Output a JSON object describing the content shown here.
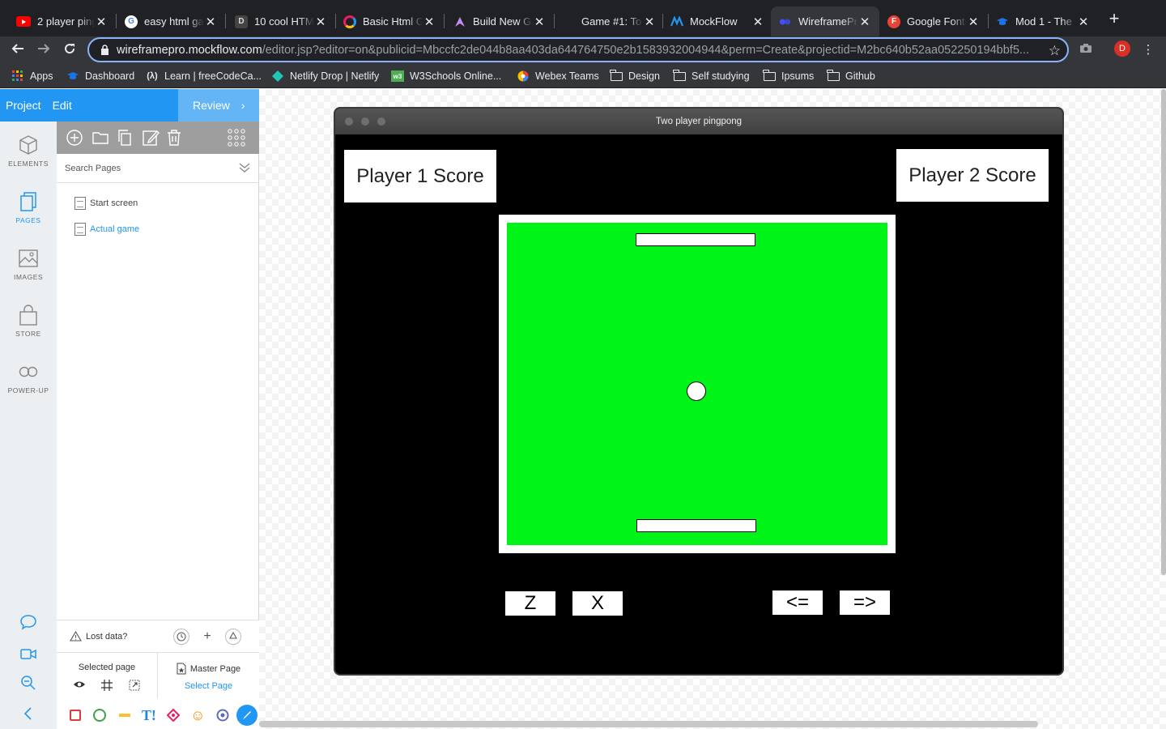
{
  "browser": {
    "tabs": [
      {
        "title": "2 player ping",
        "icon": "youtube-icon",
        "color": "#ff0000"
      },
      {
        "title": "easy html ga",
        "icon": "google-icon",
        "color": "#4285f4"
      },
      {
        "title": "10 cool HTM",
        "icon": "dev-icon",
        "color": "#333333"
      },
      {
        "title": "Basic Html G",
        "icon": "circle-logo-icon",
        "color": "#e91e63"
      },
      {
        "title": "Build New Ga",
        "icon": "triangle-logo-icon",
        "color": "#c48aef"
      },
      {
        "title": "Game #1: To",
        "icon": "",
        "color": ""
      },
      {
        "title": "MockFlow",
        "icon": "mockflow-icon",
        "color": "#2196f3"
      },
      {
        "title": "WireframePr",
        "icon": "wireframepro-icon",
        "color": "#3f51ff"
      },
      {
        "title": "Google Fonts",
        "icon": "google-fonts-icon",
        "color": "#ea4335"
      },
      {
        "title": "Mod 1 - The",
        "icon": "cap-icon",
        "color": "#1a73e8"
      }
    ],
    "url_host": "wireframepro.mockflow.com",
    "url_path": "/editor.jsp?editor=on&publicid=Mbccfc2de044b8aa403da644764750e2b1583932004944&perm=Create&projectid=M2bc640b52aa052250194bbf5...",
    "profile_initial": "D",
    "bookmarks": [
      {
        "label": "Apps",
        "icon": "apps-grid-icon"
      },
      {
        "label": "Dashboard",
        "icon": "cap-icon"
      },
      {
        "label": "Learn | freeCodeCa...",
        "icon": "freecodecamp-icon"
      },
      {
        "label": "Netlify Drop | Netlify",
        "icon": "netlify-icon"
      },
      {
        "label": "W3Schools Online...",
        "icon": "w3schools-icon"
      },
      {
        "label": "Webex Teams",
        "icon": "webex-icon"
      },
      {
        "label": "Design",
        "icon": "folder-icon"
      },
      {
        "label": "Self studying",
        "icon": "folder-icon"
      },
      {
        "label": "Ipsums",
        "icon": "folder-icon"
      },
      {
        "label": "Github",
        "icon": "folder-icon"
      }
    ]
  },
  "app": {
    "menu": {
      "project": "Project",
      "edit": "Edit",
      "review": "Review"
    },
    "leftnav": [
      {
        "label": "ELEMENTS",
        "icon": "cube-icon"
      },
      {
        "label": "PAGES",
        "icon": "pages-icon"
      },
      {
        "label": "IMAGES",
        "icon": "image-icon"
      },
      {
        "label": "STORE",
        "icon": "bag-icon"
      },
      {
        "label": "POWER-UP",
        "icon": "infinity-icon"
      }
    ],
    "pages_panel": {
      "search_placeholder": "Search Pages",
      "pages": [
        {
          "name": "Start screen",
          "active": false
        },
        {
          "name": "Actual game",
          "active": true
        }
      ],
      "lost_data": "Lost data?",
      "selected_page": "Selected page",
      "master_page": "Master Page",
      "select_page": "Select Page"
    },
    "colors": {
      "accent": "#2196f3",
      "panel": "#eceff1"
    }
  },
  "mockup": {
    "window_title": "Two player pingpong",
    "player1_score": "Player 1 Score",
    "player2_score": "Player 2 Score",
    "keys": {
      "z": "Z",
      "x": "X",
      "left": "<=",
      "right": "=>"
    },
    "colors": {
      "field": "#00f417",
      "background": "#000000"
    }
  }
}
